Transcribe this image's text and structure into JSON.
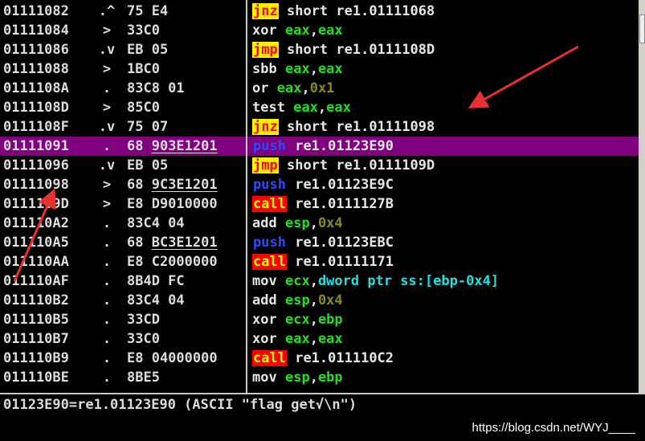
{
  "rows": [
    {
      "addr": "01111082",
      "mark": ".^",
      "hex": "75 E4",
      "hex_under": false,
      "mn": "jnz",
      "mnc": "yellow",
      "ops": [
        {
          "t": "short re1.01111068",
          "c": "tgt"
        }
      ]
    },
    {
      "addr": "01111084",
      "mark": ">",
      "hex": "33C0",
      "hex_under": false,
      "mn": "xor",
      "mnc": "plain",
      "ops": [
        {
          "t": "eax",
          "c": "reg"
        },
        {
          "t": ",",
          "c": "tgt"
        },
        {
          "t": "eax",
          "c": "reg"
        }
      ]
    },
    {
      "addr": "01111086",
      "mark": ".v",
      "hex": "EB 05",
      "hex_under": false,
      "mn": "jmp",
      "mnc": "yellow",
      "ops": [
        {
          "t": "short re1.0111108D",
          "c": "tgt"
        }
      ]
    },
    {
      "addr": "01111088",
      "mark": ">",
      "hex": "1BC0",
      "hex_under": false,
      "mn": "sbb",
      "mnc": "plain",
      "ops": [
        {
          "t": "eax",
          "c": "reg"
        },
        {
          "t": ",",
          "c": "tgt"
        },
        {
          "t": "eax",
          "c": "reg"
        }
      ]
    },
    {
      "addr": "0111108A",
      "mark": ".",
      "hex": "83C8 01",
      "hex_under": false,
      "mn": "or",
      "mnc": "plain",
      "ops": [
        {
          "t": "eax",
          "c": "reg"
        },
        {
          "t": ",",
          "c": "tgt"
        },
        {
          "t": "0x1",
          "c": "imm"
        }
      ]
    },
    {
      "addr": "0111108D",
      "mark": ">",
      "hex": "85C0",
      "hex_under": false,
      "mn": "test",
      "mnc": "plain",
      "ops": [
        {
          "t": "eax",
          "c": "reg"
        },
        {
          "t": ",",
          "c": "tgt"
        },
        {
          "t": "eax",
          "c": "reg"
        }
      ]
    },
    {
      "addr": "0111108F",
      "mark": ".v",
      "hex": "75 07",
      "hex_under": false,
      "mn": "jnz",
      "mnc": "yellow",
      "ops": [
        {
          "t": "short re1.01111098",
          "c": "tgt"
        }
      ]
    },
    {
      "addr": "01111091",
      "mark": ".",
      "hex": "68 903E1201",
      "hex_under": true,
      "mn": "push",
      "mnc": "blue",
      "ops": [
        {
          "t": "re1.01123E90",
          "c": "tgt"
        }
      ],
      "selected": true
    },
    {
      "addr": "01111096",
      "mark": ".v",
      "hex": "EB 05",
      "hex_under": false,
      "mn": "jmp",
      "mnc": "yellow",
      "ops": [
        {
          "t": "short re1.0111109D",
          "c": "tgt"
        }
      ]
    },
    {
      "addr": "01111098",
      "mark": ">",
      "hex": "68 9C3E1201",
      "hex_under": true,
      "mn": "push",
      "mnc": "blue",
      "ops": [
        {
          "t": "re1.01123E9C",
          "c": "tgt"
        }
      ]
    },
    {
      "addr": "0111109D",
      "mark": ">",
      "hex": "E8 D9010000",
      "hex_under": false,
      "mn": "call",
      "mnc": "red",
      "ops": [
        {
          "t": "re1.0111127B",
          "c": "tgt"
        }
      ]
    },
    {
      "addr": "011110A2",
      "mark": ".",
      "hex": "83C4 04",
      "hex_under": false,
      "mn": "add",
      "mnc": "plain",
      "ops": [
        {
          "t": "esp",
          "c": "reg"
        },
        {
          "t": ",",
          "c": "tgt"
        },
        {
          "t": "0x4",
          "c": "imm"
        }
      ]
    },
    {
      "addr": "011110A5",
      "mark": ".",
      "hex": "68 BC3E1201",
      "hex_under": true,
      "mn": "push",
      "mnc": "blue",
      "ops": [
        {
          "t": "re1.01123EBC",
          "c": "tgt"
        }
      ]
    },
    {
      "addr": "011110AA",
      "mark": ".",
      "hex": "E8 C2000000",
      "hex_under": false,
      "mn": "call",
      "mnc": "red",
      "ops": [
        {
          "t": "re1.01111171",
          "c": "tgt"
        }
      ]
    },
    {
      "addr": "011110AF",
      "mark": ".",
      "hex": "8B4D FC",
      "hex_under": false,
      "mn": "mov",
      "mnc": "plain",
      "ops": [
        {
          "t": "ecx",
          "c": "reg"
        },
        {
          "t": ",",
          "c": "tgt"
        },
        {
          "t": "dword ptr ss:[ebp-0x4]",
          "c": "cyan"
        }
      ]
    },
    {
      "addr": "011110B2",
      "mark": ".",
      "hex": "83C4 04",
      "hex_under": false,
      "mn": "add",
      "mnc": "plain",
      "ops": [
        {
          "t": "esp",
          "c": "reg"
        },
        {
          "t": ",",
          "c": "tgt"
        },
        {
          "t": "0x4",
          "c": "imm"
        }
      ]
    },
    {
      "addr": "011110B5",
      "mark": ".",
      "hex": "33CD",
      "hex_under": false,
      "mn": "xor",
      "mnc": "plain",
      "ops": [
        {
          "t": "ecx",
          "c": "reg"
        },
        {
          "t": ",",
          "c": "tgt"
        },
        {
          "t": "ebp",
          "c": "reg"
        }
      ]
    },
    {
      "addr": "011110B7",
      "mark": ".",
      "hex": "33C0",
      "hex_under": false,
      "mn": "xor",
      "mnc": "plain",
      "ops": [
        {
          "t": "eax",
          "c": "reg"
        },
        {
          "t": ",",
          "c": "tgt"
        },
        {
          "t": "eax",
          "c": "reg"
        }
      ]
    },
    {
      "addr": "011110B9",
      "mark": ".",
      "hex": "E8 04000000",
      "hex_under": false,
      "mn": "call",
      "mnc": "red",
      "ops": [
        {
          "t": "re1.011110C2",
          "c": "tgt"
        }
      ]
    },
    {
      "addr": "011110BE",
      "mark": ".",
      "hex": "8BE5",
      "hex_under": false,
      "mn": "mov",
      "mnc": "plain",
      "ops": [
        {
          "t": "esp",
          "c": "reg"
        },
        {
          "t": ",",
          "c": "tgt"
        },
        {
          "t": "ebp",
          "c": "reg"
        }
      ]
    }
  ],
  "info_line": "01123E90=re1.01123E90 (ASCII \"flag get√\\n\")",
  "watermark": "https://blog.csdn.net/WYJ____",
  "colors": {
    "selection": "#800080",
    "arrow": "#e83030"
  }
}
